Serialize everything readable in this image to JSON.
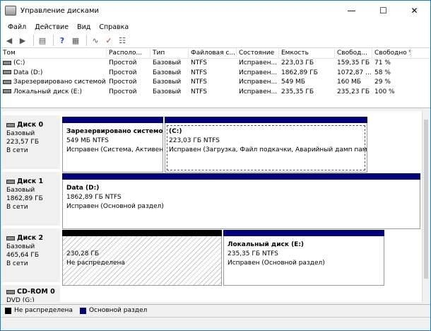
{
  "window": {
    "title": "Управление дисками"
  },
  "menu": [
    "Файл",
    "Действие",
    "Вид",
    "Справка"
  ],
  "columns": [
    "Том",
    "Располо...",
    "Тип",
    "Файловая с...",
    "Состояние",
    "Емкость",
    "Свобод...",
    "Свободно %"
  ],
  "volumes": [
    [
      "(C:)",
      "Простой",
      "Базовый",
      "NTFS",
      "Исправен...",
      "223,03 ГБ",
      "159,35 ГБ",
      "71 %"
    ],
    [
      "Data (D:)",
      "Простой",
      "Базовый",
      "NTFS",
      "Исправен...",
      "1862,89 ГБ",
      "1072,87 ...",
      "58 %"
    ],
    [
      "Зарезервировано системой",
      "Простой",
      "Базовый",
      "NTFS",
      "Исправен...",
      "549 МБ",
      "160 МБ",
      "29 %"
    ],
    [
      "Локальный диск (E:)",
      "Простой",
      "Базовый",
      "NTFS",
      "Исправен...",
      "235,35 ГБ",
      "235,23 ГБ",
      "100 %"
    ]
  ],
  "disks": [
    {
      "name": "Диск 0",
      "type": "Базовый",
      "size": "223,57 ГБ",
      "status": "В сети",
      "parts": [
        {
          "title": "Зарезервировано системой",
          "size": "549 МБ NTFS",
          "state": "Исправен (Система, Активен,"
        },
        {
          "title": "(C:)",
          "size": "223,03 ГБ NTFS",
          "state": "Исправен (Загрузка, Файл подкачки, Аварийный дамп памят"
        }
      ]
    },
    {
      "name": "Диск 1",
      "type": "Базовый",
      "size": "1862,89 ГБ",
      "status": "В сети",
      "parts": [
        {
          "title": "Data  (D:)",
          "size": "1862,89 ГБ NTFS",
          "state": "Исправен (Основной раздел)"
        }
      ]
    },
    {
      "name": "Диск 2",
      "type": "Базовый",
      "size": "465,64 ГБ",
      "status": "В сети",
      "parts": [
        {
          "title": "",
          "size": "230,28 ГБ",
          "state": "Не распределена"
        },
        {
          "title": "Локальный диск  (E:)",
          "size": "235,35 ГБ NTFS",
          "state": "Исправен (Основной раздел)"
        }
      ]
    },
    {
      "name": "CD-ROM 0",
      "type": "DVD (G:)",
      "size": "",
      "status": "",
      "parts": []
    }
  ],
  "legend": [
    {
      "label": "Не распределена",
      "color": "#000000"
    },
    {
      "label": "Основной раздел",
      "color": "#020076"
    }
  ]
}
